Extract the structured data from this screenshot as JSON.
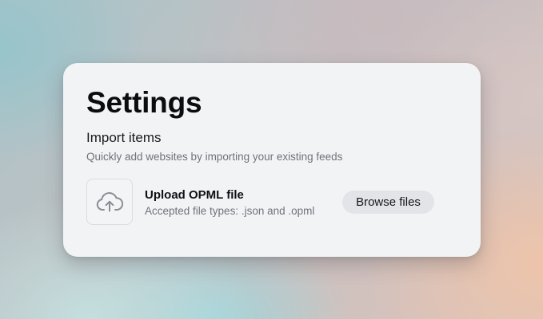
{
  "settings": {
    "title": "Settings"
  },
  "import_section": {
    "title": "Import items",
    "description": "Quickly add websites by importing your existing feeds"
  },
  "upload": {
    "icon": "cloud-upload-icon",
    "file_label": "Upload OPML file",
    "accepted_types": "Accepted file types: .json and .opml",
    "browse_label": "Browse files"
  }
}
